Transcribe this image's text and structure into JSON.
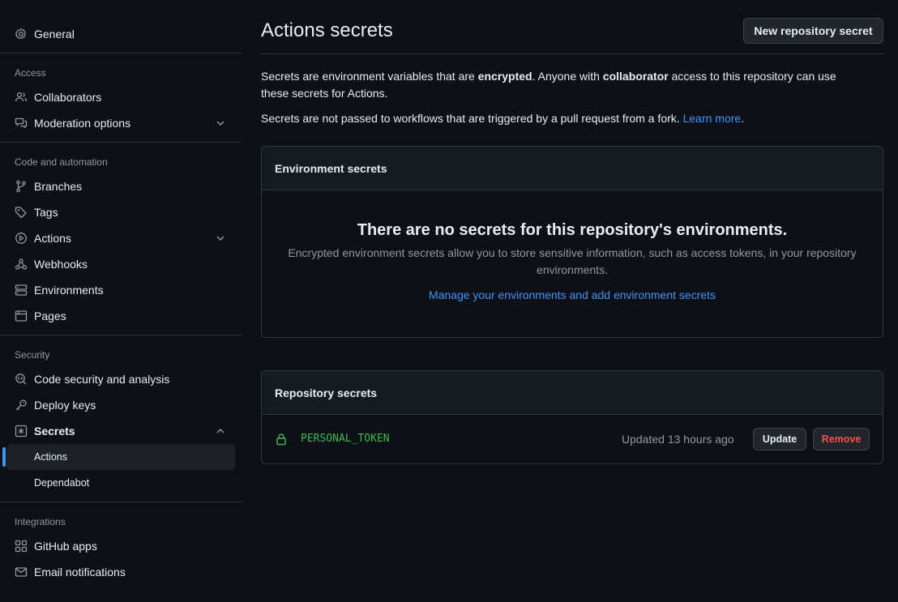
{
  "sidebar": {
    "general": "General",
    "access_label": "Access",
    "collaborators": "Collaborators",
    "moderation": "Moderation options",
    "code_automation_label": "Code and automation",
    "branches": "Branches",
    "tags": "Tags",
    "actions": "Actions",
    "webhooks": "Webhooks",
    "environments": "Environments",
    "pages": "Pages",
    "security_label": "Security",
    "code_security": "Code security and analysis",
    "deploy_keys": "Deploy keys",
    "secrets": "Secrets",
    "secrets_actions": "Actions",
    "secrets_dependabot": "Dependabot",
    "integrations_label": "Integrations",
    "github_apps": "GitHub apps",
    "email_notifications": "Email notifications"
  },
  "main": {
    "title": "Actions secrets",
    "new_secret_button": "New repository secret",
    "intro_1a": "Secrets are environment variables that are ",
    "intro_1b": "encrypted",
    "intro_1c": ". Anyone with ",
    "intro_1d": "collaborator",
    "intro_1e": " access to this repository can use these secrets for Actions.",
    "intro_2a": "Secrets are not passed to workflows that are triggered by a pull request from a fork. ",
    "learn_more": "Learn more",
    "intro_2b": ".",
    "env_secrets": {
      "header": "Environment secrets",
      "blank_title": "There are no secrets for this repository's environments.",
      "blank_desc": "Encrypted environment secrets allow you to store sensitive information, such as access tokens, in your repository environments.",
      "manage_link": "Manage your environments and add environment secrets"
    },
    "repo_secrets": {
      "header": "Repository secrets",
      "items": [
        {
          "name": "PERSONAL_TOKEN",
          "updated": "Updated 13 hours ago",
          "update_label": "Update",
          "remove_label": "Remove"
        }
      ]
    }
  },
  "colors": {
    "background": "#0d1117",
    "accent": "#4493f8",
    "secret_name": "#3fb950",
    "danger": "#f85149"
  }
}
